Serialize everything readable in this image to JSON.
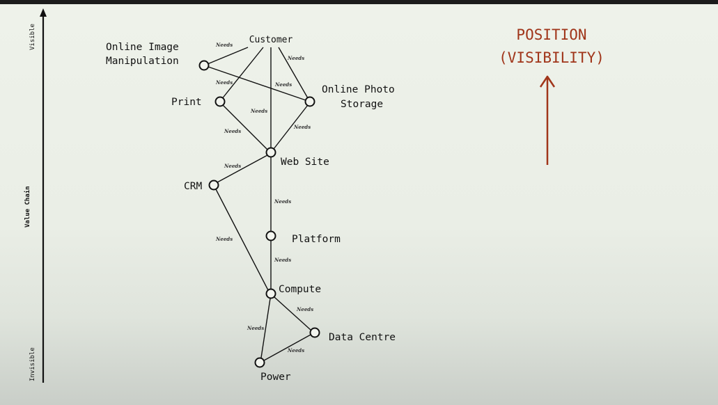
{
  "axis": {
    "label": "Value Chain",
    "top_label": "Visible",
    "bottom_label": "Invisible"
  },
  "headline": {
    "line1": "POSITION",
    "line2": "(VISIBILITY)"
  },
  "nodes": [
    {
      "id": "customer",
      "label": "Customer"
    },
    {
      "id": "online-image-manipulation",
      "label_lines": [
        "Online Image",
        "Manipulation"
      ]
    },
    {
      "id": "online-photo-storage",
      "label_lines": [
        "Online Photo",
        "Storage"
      ]
    },
    {
      "id": "print",
      "label": "Print"
    },
    {
      "id": "web-site",
      "label": "Web Site"
    },
    {
      "id": "crm",
      "label": "CRM"
    },
    {
      "id": "platform",
      "label": "Platform"
    },
    {
      "id": "compute",
      "label": "Compute"
    },
    {
      "id": "data-centre",
      "label": "Data Centre"
    },
    {
      "id": "power",
      "label": "Power"
    }
  ],
  "edges": [
    {
      "from": "customer",
      "to": "online-image-manipulation",
      "label": "Needs"
    },
    {
      "from": "customer",
      "to": "print",
      "label": "Needs"
    },
    {
      "from": "customer",
      "to": "web-site",
      "label": ""
    },
    {
      "from": "customer",
      "to": "online-photo-storage",
      "label": "Needs"
    },
    {
      "from": "online-image-manipulation",
      "to": "online-photo-storage",
      "label": "Needs"
    },
    {
      "from": "print",
      "to": "web-site",
      "label": "Needs"
    },
    {
      "from": "online-photo-storage",
      "to": "web-site",
      "label": "Needs"
    },
    {
      "from": "web-site",
      "to": "crm",
      "label": "Needs"
    },
    {
      "from": "web-site",
      "to": "platform",
      "label": "Needs"
    },
    {
      "from": "crm",
      "to": "compute",
      "label": "Needs"
    },
    {
      "from": "platform",
      "to": "compute",
      "label": "Needs"
    },
    {
      "from": "compute",
      "to": "data-centre",
      "label": "Needs"
    },
    {
      "from": "compute",
      "to": "power",
      "label": "Needs"
    },
    {
      "from": "data-centre",
      "to": "power",
      "label": "Needs"
    }
  ],
  "extra_labels": [
    "Needs",
    "Needs",
    "Needs"
  ],
  "colors": {
    "accent": "#a0351a",
    "line": "#111111",
    "background": "#eef2ea"
  }
}
